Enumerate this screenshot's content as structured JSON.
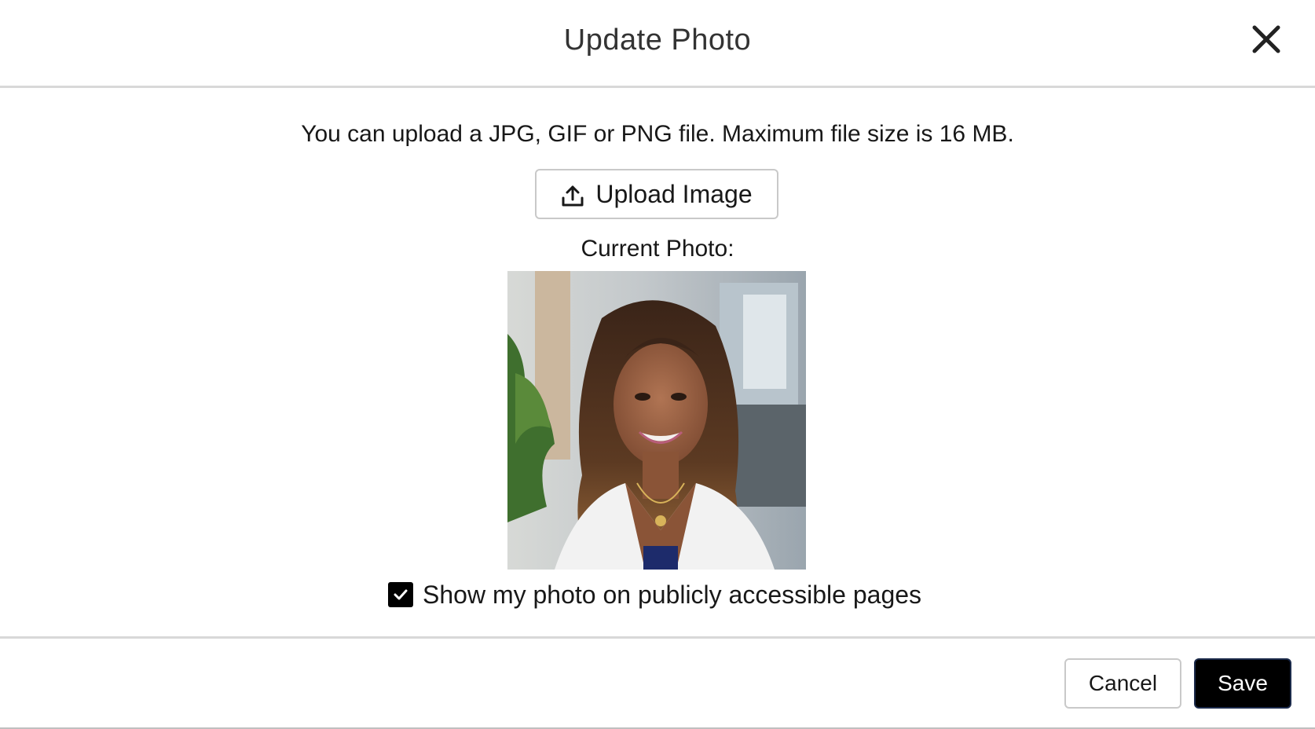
{
  "dialog": {
    "title": "Update Photo",
    "close_icon": "close-icon"
  },
  "body": {
    "info_text": "You can upload a JPG, GIF or PNG file. Maximum file size is 16 MB.",
    "upload_button": {
      "label": "Upload Image",
      "icon": "upload-icon"
    },
    "current_photo_label": "Current Photo:",
    "photo_alt": "Current profile photo",
    "public_checkbox": {
      "label": "Show my photo on publicly accessible pages",
      "checked": true
    }
  },
  "footer": {
    "cancel_label": "Cancel",
    "save_label": "Save"
  },
  "colors": {
    "primary_button_bg": "#000000",
    "primary_button_border": "#1b2a4a",
    "divider": "#d8d8d8",
    "text": "#181818"
  }
}
